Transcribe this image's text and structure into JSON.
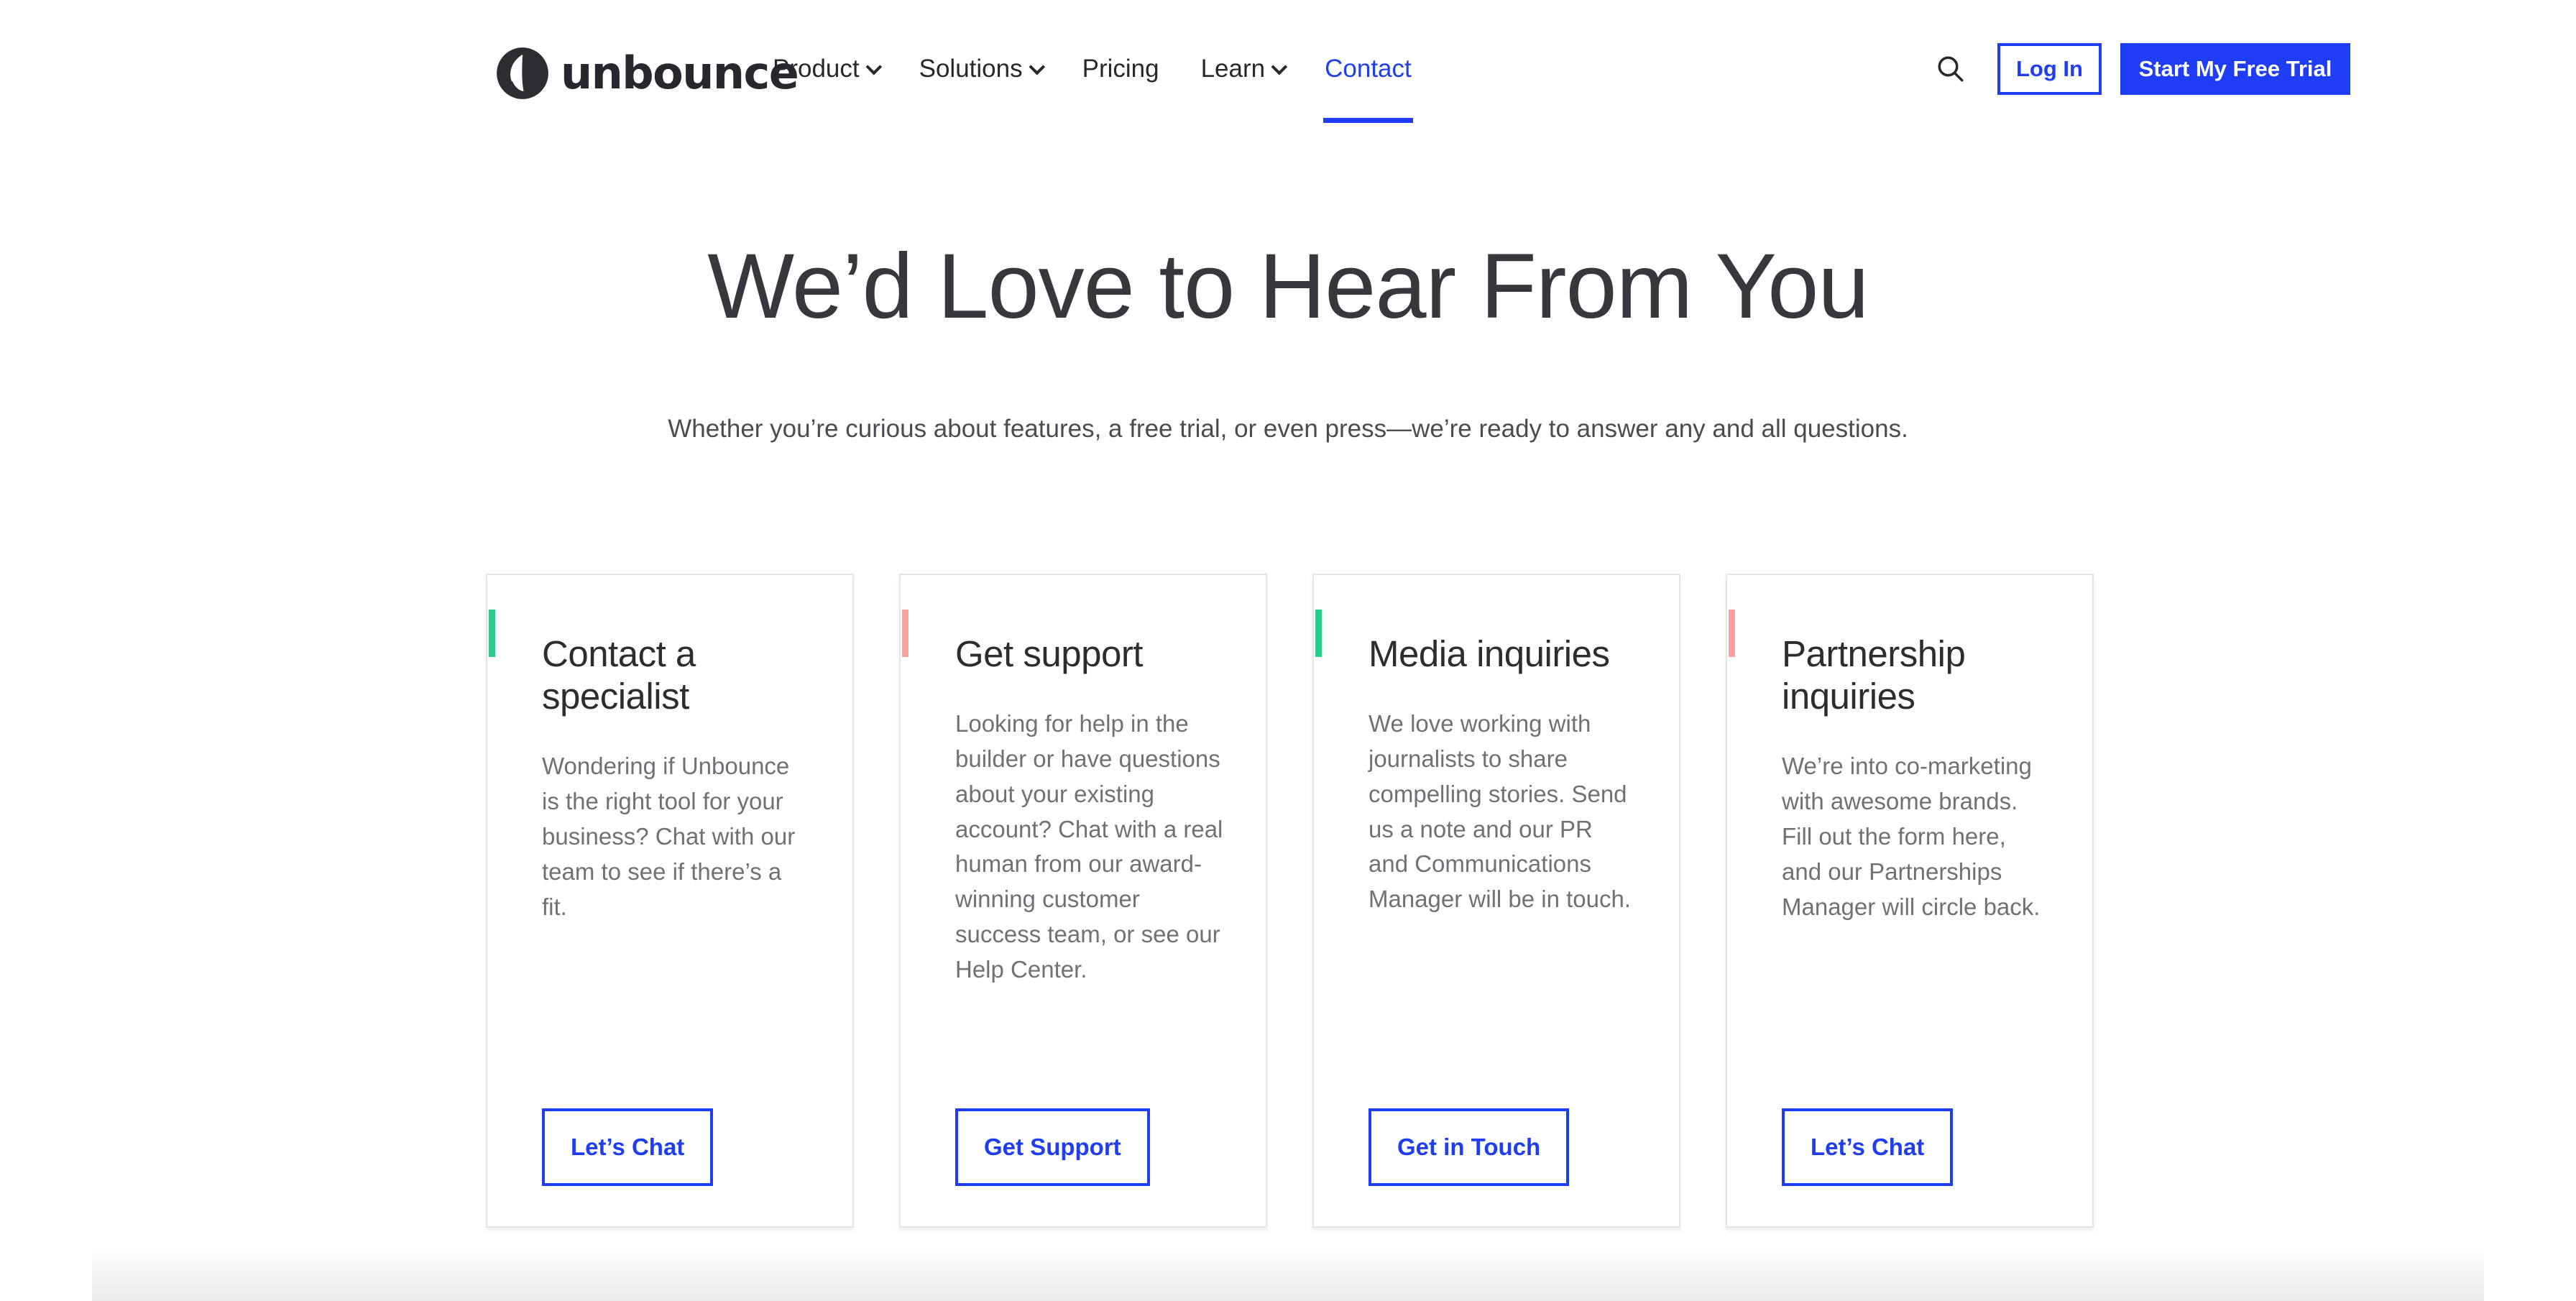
{
  "header": {
    "logo": {
      "icon": "unbounce-logo-icon",
      "text": "unbounce"
    },
    "nav": [
      {
        "label": "Product",
        "has_caret": true,
        "active": false
      },
      {
        "label": "Solutions",
        "has_caret": true,
        "active": false
      },
      {
        "label": "Pricing",
        "has_caret": false,
        "active": false
      },
      {
        "label": "Learn",
        "has_caret": true,
        "active": false
      },
      {
        "label": "Contact",
        "has_caret": false,
        "active": true
      }
    ],
    "search_icon": "search-icon",
    "login_label": "Log In",
    "trial_label": "Start My Free Trial"
  },
  "hero": {
    "title": "We’d Love to Hear From You",
    "subtitle": "Whether you’re curious about features, a free trial, or even press—we’re ready to answer any and all questions."
  },
  "cards": [
    {
      "accent_color": "#2DCC8A",
      "title": "Contact a specialist",
      "body": "Wondering if Unbounce is the right tool for your business? Chat with our team to see if there’s a fit.",
      "button": "Let’s Chat"
    },
    {
      "accent_color": "#FF9E9E",
      "title": "Get support",
      "body": "Looking for help in the builder or have questions about your existing account? Chat with a real human from our award-winning customer success team, or see our Help Center.",
      "button": "Get Support"
    },
    {
      "accent_color": "#2DCC8A",
      "title": "Media inquiries",
      "body": "We love working with journalists to share compelling stories. Send us a note and our PR and Communications Manager will be in touch.",
      "button": "Get in Touch"
    },
    {
      "accent_color": "#FF9E9E",
      "title": "Partnership inquiries",
      "body": "We’re into co-marketing with awesome brands. Fill out the form here, and our Partnerships Manager will circle back.",
      "button": "Let’s Chat"
    }
  ],
  "colors": {
    "brand_blue": "#1E3DF5",
    "accent_green": "#2DCC8A",
    "accent_pink": "#FF9E9E",
    "text_dark": "#2B2D31",
    "text_muted": "#6E7175"
  }
}
